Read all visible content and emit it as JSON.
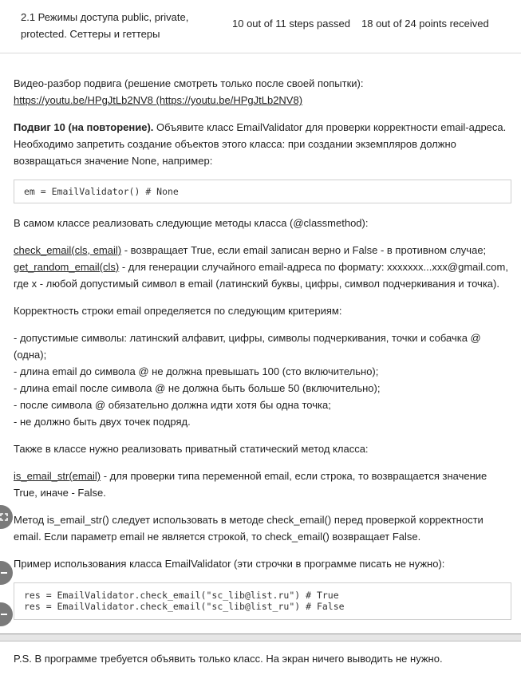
{
  "header": {
    "lesson_title": "2.1 Режимы доступа public, private, protected. Сеттеры и геттеры",
    "steps": "10 out of 11 steps passed",
    "points": "18 out of 24 points  received"
  },
  "content": {
    "video_intro": "Видео-разбор подвига (решение смотреть только после своей попытки):",
    "video_link": "https://youtu.be/HPgJtLb2NV8 (https://youtu.be/HPgJtLb2NV8)",
    "task_bold": "Подвиг 10 (на повторение).",
    "task_text": " Объявите класс EmailValidator для проверки корректности email-адреса. Необходимо запретить создание объектов этого класса: при создании экземпляров должно возвращаться значение None, например:",
    "code1": [
      "em = EmailValidator() # None"
    ],
    "methods_intro": "В самом классе реализовать следующие методы класса (@classmethod):",
    "method1_name": "check_email(cls, email)",
    "method1_desc": " - возвращает True, если email записан верно и False - в противном случае;",
    "method2_name": "get_random_email(cls)",
    "method2_desc": " - для генерации случайного email-адреса по формату: xxxxxxx...xxx@gmail.com, где x - любой допустимый символ в email (латинский буквы, цифры, символ подчеркивания и точка).",
    "criteria_intro": "Корректность строки email определяется по следующим критериям:",
    "criteria": [
      "- допустимые символы: латинский алфавит, цифры, символы подчеркивания, точки и собачка @ (одна);",
      "- длина email до символа @ не должна превышать 100 (сто включительно);",
      "- длина email после символа @ не должна быть больше 50 (включительно);",
      "- после символа @ обязательно должна идти хотя бы одна точка;",
      "- не должно быть двух точек подряд."
    ],
    "static_intro": "Также в классе нужно реализовать приватный статический метод класса:",
    "static_name": "is_email_str(email)",
    "static_desc": " - для проверки типа переменной email, если строка, то возвращается значение True, иначе - False.",
    "usage_note": "Метод is_email_str() следует использовать в методе check_email() перед проверкой корректности email. Если параметр email не является строкой, то check_email() возвращает False.",
    "example_intro": "Пример использования класса EmailValidator (эти строчки в программе писать не нужно):",
    "code2": [
      "res = EmailValidator.check_email(\"sc_lib@list.ru\") # True",
      "res = EmailValidator.check_email(\"sc_lib@list_ru\") # False"
    ],
    "ps_text": "P.S. В программе требуется объявить только класс. На экран ничего выводить не нужно."
  },
  "side_controls": {
    "expand_icon": "expand-icon",
    "minus_icon": "minus-icon"
  },
  "colors": {
    "text": "#222222",
    "border": "#cfcfcf",
    "scrollbar": "#e6e6e6",
    "side_button": "#7a7a7a"
  }
}
